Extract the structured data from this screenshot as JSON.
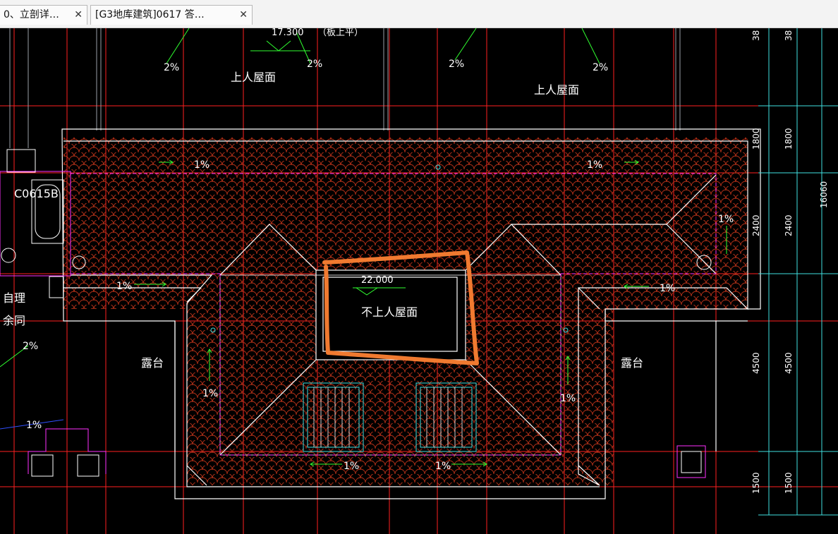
{
  "tabs": [
    {
      "label": "0、立剖详…",
      "close": "✕"
    },
    {
      "label": "[G3地库建筑]0617 答…",
      "close": "✕"
    }
  ],
  "drawing": {
    "elevation_top": "17.300",
    "elevation_top_note": "（板上平）",
    "elevation_mid": "22.000",
    "roof_accessible": "上人屋面",
    "roof_non_accessible": "不上人屋面",
    "terrace": "露台",
    "slope_2": "2%",
    "slope_1": "1%",
    "window_tag": "C0615B",
    "left_note_1": "自理",
    "left_note_2": "余同",
    "dims": [
      "1800",
      "2400",
      "4500",
      "1500"
    ],
    "dim_total": "16060",
    "dim_top": "38"
  },
  "colors": {
    "background": "#000000",
    "tile": "#b03018",
    "grid_red": "#ff2020",
    "wall_white": "#ffffff",
    "magenta": "#ff30ff",
    "cyan": "#40e0e0",
    "green": "#30ff30",
    "markup_orange": "#f07a30"
  }
}
